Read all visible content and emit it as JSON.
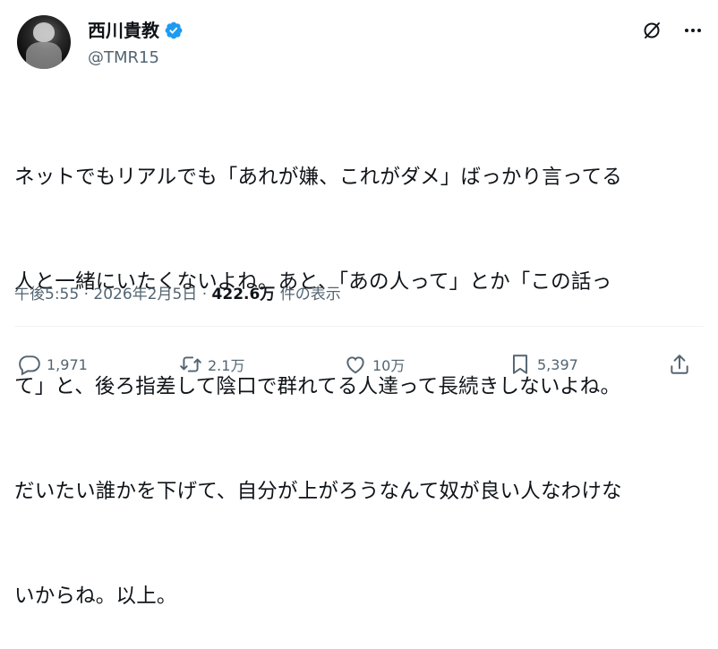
{
  "author": {
    "display_name": "西川貴教",
    "handle": "@TMR15",
    "verified_color": "#1d9bf0"
  },
  "tweet": {
    "lines": [
      "ネットでもリアルでも「あれが嫌、これがダメ」ばっかり言ってる",
      "人と一緒にいたくないよね。あと、「あの人って」とか「この話っ",
      "て」と、後ろ指差して陰口で群れてる人達って長続きしないよね。",
      "だいたい誰かを下げて、自分が上がろうなんて奴が良い人なわけな",
      "いからね。以上。"
    ]
  },
  "meta": {
    "time": "午後5:55",
    "separator": "·",
    "date": "2026年2月5日",
    "views_count": "422.6万",
    "views_label": "件の表示"
  },
  "actions": {
    "reply_count": "1,971",
    "repost_count": "2.1万",
    "like_count": "10万",
    "bookmark_count": "5,397"
  },
  "icons": {
    "header": [
      "grok-icon",
      "more-icon"
    ],
    "actions": [
      "reply-icon",
      "repost-icon",
      "like-icon",
      "bookmark-icon",
      "share-icon"
    ]
  },
  "colors": {
    "text": "#0f1419",
    "secondary": "#536471",
    "verified": "#1d9bf0"
  }
}
